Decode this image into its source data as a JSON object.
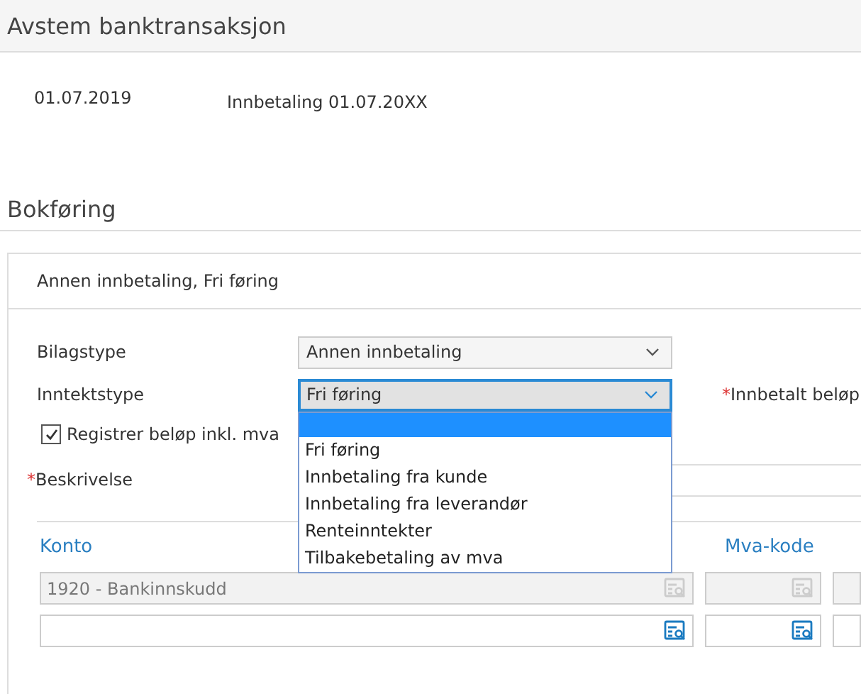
{
  "header": {
    "title": "Avstem banktransaksjon"
  },
  "transaction": {
    "date": "01.07.2019",
    "text": "Innbetaling 01.07.20XX"
  },
  "section": {
    "title": "Bokføring"
  },
  "panel": {
    "title": "Annen innbetaling, Fri føring",
    "bilagstype": {
      "label": "Bilagstype",
      "value": "Annen innbetaling"
    },
    "inntektstype": {
      "label": "Inntektstype",
      "value": "Fri føring",
      "expanded": true
    },
    "amount_label": {
      "mark": "*",
      "label": "Innbetalt beløp"
    },
    "incl_vat": {
      "label": "Registrer beløp inkl. mva",
      "checked": true
    },
    "description_label": {
      "mark": "*",
      "label": "Beskrivelse"
    },
    "options": [
      {
        "selected": true
      },
      {
        "label": "Fri føring",
        "selected": false
      },
      {
        "label": "Innbetaling fra kunde",
        "selected": false
      },
      {
        "label": "Innbetaling fra leverandør",
        "selected": false
      },
      {
        "label": "Renteinntekter",
        "selected": false
      },
      {
        "label": "Tilbakebetaling av mva",
        "selected": false
      }
    ]
  },
  "table": {
    "columns": [
      "Konto",
      "Mva-kode"
    ],
    "rows": [
      {
        "konto": "1920 - Bankinnskudd",
        "disabled": true
      },
      {
        "disabled": false
      }
    ]
  }
}
